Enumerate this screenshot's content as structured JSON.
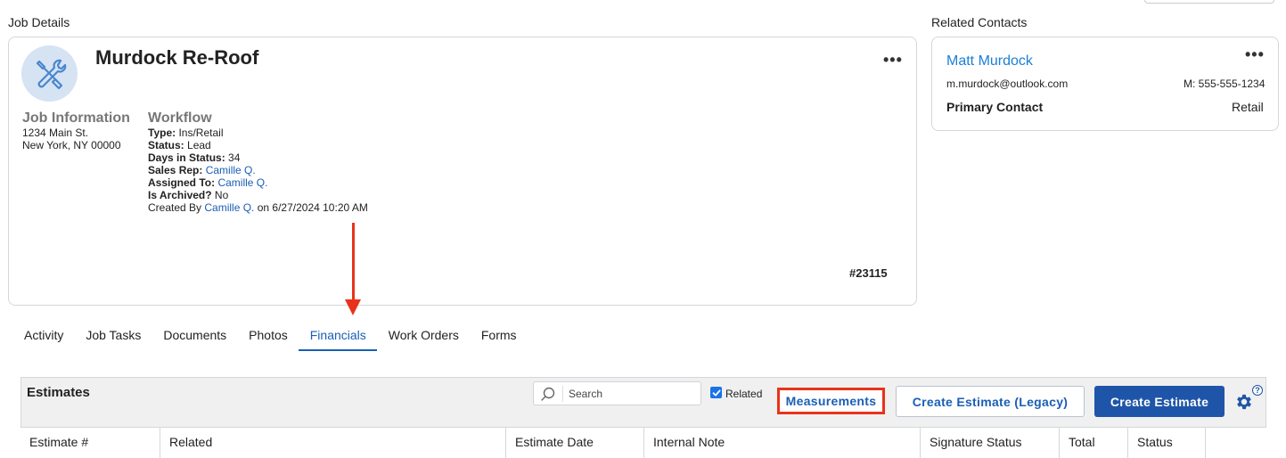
{
  "job_details": {
    "section_label": "Job Details",
    "title": "Murdock Re-Roof",
    "more_label": "•••",
    "job_information": {
      "heading": "Job Information",
      "address_line1": "1234 Main St.",
      "address_line2": "New York, NY 00000"
    },
    "workflow": {
      "heading": "Workflow",
      "type_label": "Type:",
      "type_value": "Ins/Retail",
      "status_label": "Status:",
      "status_value": "Lead",
      "days_label": "Days in Status:",
      "days_value": "34",
      "sales_rep_label": "Sales Rep:",
      "sales_rep_value": "Camille Q.",
      "assigned_label": "Assigned To:",
      "assigned_value": "Camille Q.",
      "archived_label": "Is Archived?",
      "archived_value": "No",
      "created_by_prefix": "Created By",
      "created_by_user": "Camille Q.",
      "created_on": "on 6/27/2024 10:20 AM"
    },
    "job_number": "#23115"
  },
  "related_contacts": {
    "section_label": "Related Contacts",
    "more_label": "•••",
    "name": "Matt Murdock",
    "email": "m.murdock@outlook.com",
    "phone": "M: 555-555-1234",
    "role": "Primary Contact",
    "category": "Retail"
  },
  "tabs": [
    {
      "label": "Activity"
    },
    {
      "label": "Job Tasks"
    },
    {
      "label": "Documents"
    },
    {
      "label": "Photos"
    },
    {
      "label": "Financials",
      "active": true
    },
    {
      "label": "Work Orders"
    },
    {
      "label": "Forms"
    }
  ],
  "estimates": {
    "title": "Estimates",
    "search_placeholder": "Search",
    "related_label": "Related",
    "related_checked": true,
    "measurements_label": "Measurements",
    "legacy_label": "Create Estimate (Legacy)",
    "create_label": "Create Estimate",
    "help_label": "?",
    "columns": [
      "Estimate #",
      "Related",
      "Estimate Date",
      "Internal Note",
      "Signature Status",
      "Total",
      "Status",
      ""
    ]
  },
  "colors": {
    "accent": "#1f55a8",
    "link": "#1a5fb4",
    "highlight": "#e8331c"
  },
  "icons": {
    "avatar": "tools-icon",
    "search": "search-icon",
    "settings": "gear-icon",
    "annotation": "arrow-down-icon"
  }
}
